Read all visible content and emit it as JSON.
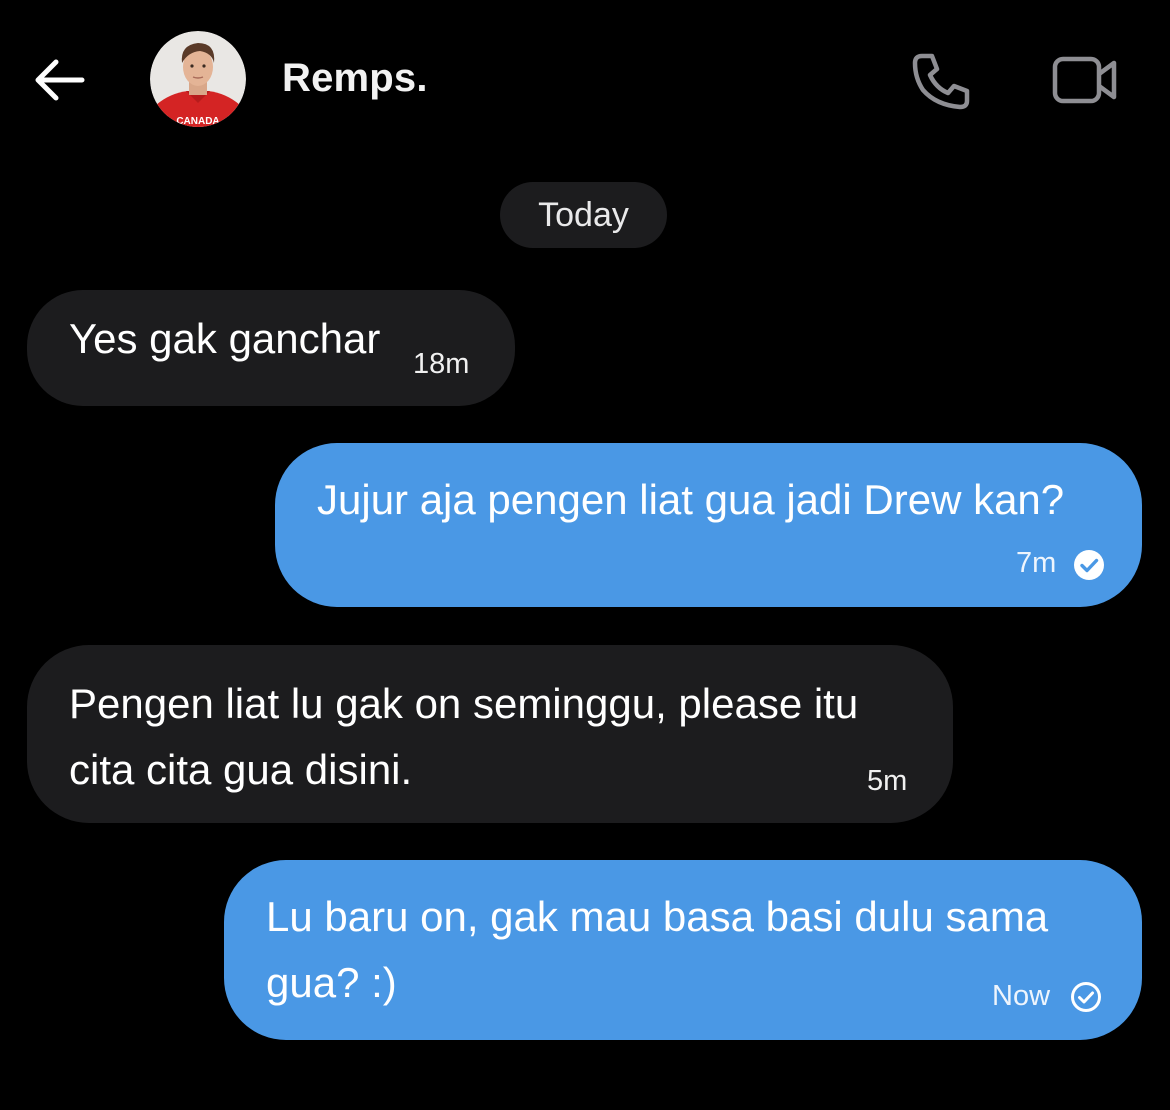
{
  "header": {
    "back_icon": "arrow-left-icon",
    "contact_name": "Remps.",
    "avatar_jersey_text": "CANADA",
    "call_icon": "phone-icon",
    "video_icon": "video-camera-icon"
  },
  "date_separator": "Today",
  "messages": [
    {
      "direction": "incoming",
      "lines": [
        "Yes gak ganchar"
      ],
      "time": "18m"
    },
    {
      "direction": "outgoing",
      "lines": [
        "Jujur aja pengen liat gua jadi Drew kan?"
      ],
      "time": "7m",
      "status": "read",
      "status_icon": "check-circle-filled-icon"
    },
    {
      "direction": "incoming",
      "lines": [
        "Pengen liat lu gak on seminggu, please itu",
        "cita cita gua disini."
      ],
      "time": "5m"
    },
    {
      "direction": "outgoing",
      "lines": [
        "Lu baru on, gak mau basa basi dulu sama",
        "gua? :)"
      ],
      "time": "Now",
      "status": "sent",
      "status_icon": "check-circle-outline-icon"
    }
  ],
  "colors": {
    "background": "#000000",
    "incoming_bubble": "#1c1c1e",
    "outgoing_bubble": "#4a98e5",
    "icon_gray": "#8e8e93",
    "text": "#ffffff"
  }
}
